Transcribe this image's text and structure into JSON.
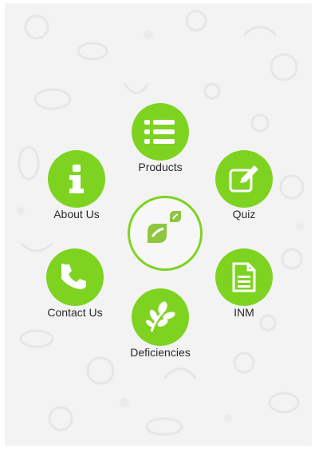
{
  "menu": {
    "products": {
      "label": "Products",
      "icon": "list-icon"
    },
    "about_us": {
      "label": "About Us",
      "icon": "info-icon"
    },
    "quiz": {
      "label": "Quiz",
      "icon": "edit-icon"
    },
    "contact_us": {
      "label": "Contact Us",
      "icon": "phone-icon"
    },
    "inm": {
      "label": "INM",
      "icon": "document-icon"
    },
    "deficiencies": {
      "label": "Deficiencies",
      "icon": "leaf-sprig-icon"
    }
  },
  "logo": {
    "icon": "app-logo-icon"
  },
  "colors": {
    "accent": "#7ed321",
    "background": "#f3f3f3",
    "text": "#2a2a2a"
  }
}
